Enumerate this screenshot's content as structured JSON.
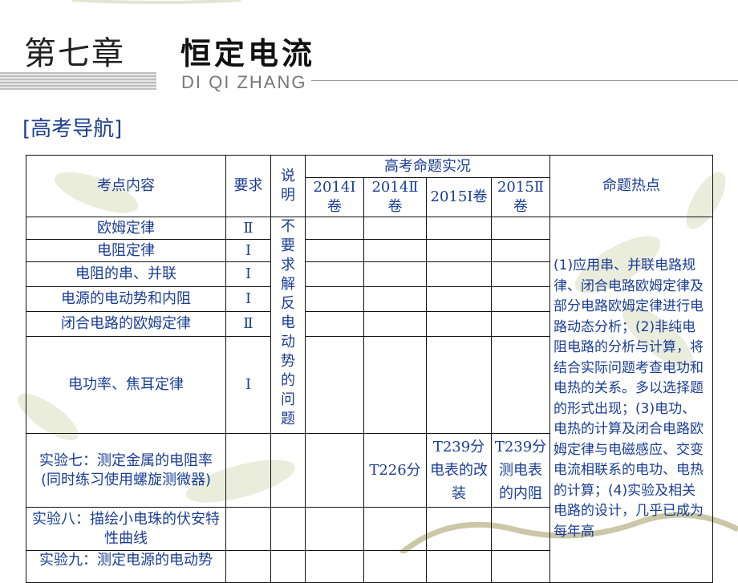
{
  "header": {
    "chapter": "第七章",
    "chapter_name": "恒定电流",
    "pinyin": "DI QI ZHANG"
  },
  "section_label": "[高考导航]",
  "table": {
    "headers": {
      "content": "考点内容",
      "requirement": "要求",
      "note": "说明",
      "exam_group": "高考命题实况",
      "exam_cols": [
        "2014Ⅰ卷",
        "2014Ⅱ卷",
        "2015Ⅰ卷",
        "2015Ⅱ卷"
      ],
      "hot": "命题热点"
    },
    "rows": [
      {
        "content": "欧姆定律",
        "requirement": "Ⅱ"
      },
      {
        "content": "电阻定律",
        "requirement": "Ⅰ"
      },
      {
        "content": "电阻的串、并联",
        "requirement": "Ⅰ"
      },
      {
        "content": "电源的电动势和内阻",
        "requirement": "Ⅰ"
      },
      {
        "content": "闭合电路的欧姆定律",
        "requirement": "Ⅱ"
      },
      {
        "content": "电功率、焦耳定律",
        "requirement": "Ⅰ"
      },
      {
        "content": "实验七：测定金属的电阻率(同时练习使用螺旋测微器)",
        "requirement": "",
        "exam": [
          "",
          "T226分",
          "T239分电表的改装",
          "T239分测电表的内阻"
        ]
      },
      {
        "content": "实验八：描绘小电珠的伏安特性曲线",
        "requirement": ""
      },
      {
        "content": "实验九：测定电源的电动势",
        "requirement": ""
      }
    ],
    "note_text": "不要求解反电动势的问题",
    "hot_text": "(1)应用串、并联电路规律、闭合电路欧姆定律及部分电路欧姆定律进行电路动态分析；(2)非纯电阻电路的分析与计算，将结合实际问题考查电功和电热的关系。多以选择题的形式出现；(3)电功、电热的计算及闭合电路欧姆定律与电磁感应、交变电流相联系的电功、电热的计算；(4)实验及相关电路的设计，几乎已成为每年高"
  }
}
